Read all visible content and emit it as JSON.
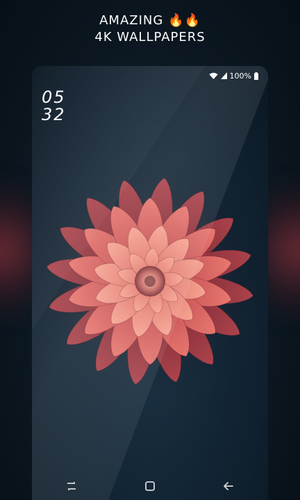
{
  "promo": {
    "line1": "AMAZING 🔥🔥",
    "line2": "4K WALLPAPERS"
  },
  "status_bar": {
    "battery_text": "100%",
    "icons": [
      "wifi-icon",
      "signal-icon",
      "battery-icon"
    ]
  },
  "lock_clock": {
    "hour": "05",
    "minute": "32"
  },
  "nav_bar": {
    "buttons": [
      "recent-apps-icon",
      "home-icon",
      "back-icon"
    ]
  },
  "colors": {
    "petal": "#e2625e",
    "petal_light": "#f3978a",
    "petal_dark": "#8e2a30",
    "background": "#0b1620"
  }
}
